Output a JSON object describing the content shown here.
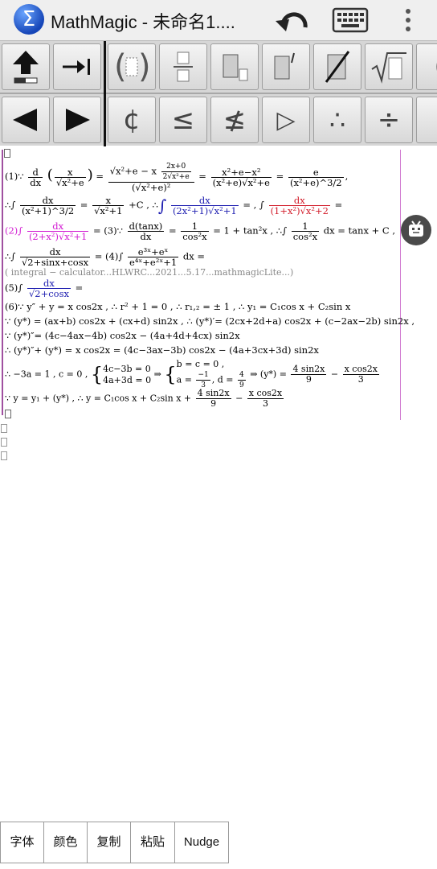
{
  "titlebar": {
    "app_icon_glyph": "Σ",
    "title": "MathMagic - 未命名1....",
    "undo_icon": "undo-icon",
    "keyboard_icon": "keyboard-icon",
    "menu_icon": "more-vertical-icon"
  },
  "toolbar": {
    "row1": [
      "arrow-up-icon",
      "tab-icon",
      "parentheses-template-icon",
      "fraction-template-icon",
      "subscript-template-icon",
      "prime-template-icon",
      "cancel-template-icon",
      "sqrt-template-icon",
      "more-template-icon"
    ],
    "row2": [
      "arrow-left-icon",
      "arrow-right-icon",
      "not-subset-icon",
      "less-equal-icon",
      "not-less-equal-icon",
      "triangle-right-icon",
      "therefore-icon",
      "divide-icon",
      "more-symbol-icon"
    ],
    "row2_glyphs": {
      "cent": "¢",
      "le": "≤",
      "nle": "≰",
      "tri": "▷",
      "therefore": "∴",
      "divide": "÷"
    }
  },
  "editor": {
    "l1_label": "(1)∵",
    "l1_d": "d",
    "l1_dx": "dx",
    "l1_x": "x",
    "l1_sqrt": "√x²+e",
    "l1_num": "√x²+e − x",
    "l1_num_frac_n": "2x+0",
    "l1_num_frac_d": "2√x²+e",
    "l1_den": "(√x²+e)²",
    "l1_r1n": "x²+e−x²",
    "l1_r1d": "(x²+e)√x²+e",
    "l1_r2n": "e",
    "l1_r2d": "(x²+e)^3/2",
    "l1_tail": ",",
    "l2_pre": "∴∫",
    "l2_f1n": "dx",
    "l2_f1d": "(x²+1)^3/2",
    "l2_f2n": "x",
    "l2_f2d": "√x²+1",
    "l2_mid": "+C , ∴",
    "l2_f3n": "dx",
    "l2_f3d": "(2x²+1)√x²+1",
    "l2_eq": "= , ∫",
    "l2_f4n": "dx",
    "l2_f4d": "(1+x²)√x²+2",
    "l2_end": "=",
    "l3_label": "(2)∫",
    "l3_f1n": "dx",
    "l3_f1d": "(2+x²)√x²+1",
    "l3_mid": "= (3)∵",
    "l3_f2n": "d(tanx)",
    "l3_f2d": "dx",
    "l3_eq": "=",
    "l3_f3n": "1",
    "l3_f3d": "cos²x",
    "l3_mid2": "= 1 + tan²x , ∴∫",
    "l3_f4n": "1",
    "l3_f4d": "cos²x",
    "l3_end": "dx = tanx + C ,",
    "l4_pre": "∴∫",
    "l4_f1n": "dx",
    "l4_f1d": "√2+sinx+cosx",
    "l4_mid": "= (4)∫",
    "l4_f2n": "e³ˣ+eˣ",
    "l4_f2d": "e⁴ˣ+e²ˣ+1",
    "l4_end": "dx =",
    "l5_watermark": "( integral − calculator...HLWRC...2021...5.17...mathmagicLite...)",
    "l6_label": "(5)∫",
    "l6_fn": "dx",
    "l6_fd": "√2+cosx",
    "l6_end": "=",
    "l7": "(6)∵ y″ + y = x cos2x , ∴ r² + 1 = 0 , ∴ r₁,₂ = ± 1 , ∴ y₁ = C₁cos x + C₂sin x",
    "l8": "∵ (y*) = (ax+b) cos2x + (cx+d) sin2x , ∴ (y*)′= (2cx+2d+a) cos2x + (c−2ax−2b) sin2x ,",
    "l9": "∵ (y*)″= (4c−4ax−4b) cos2x − (4a+4d+4cx) sin2x",
    "l10": "∴ (y*)″+ (y*) = x cos2x = (4c−3ax−3b) cos2x − (4a+3cx+3d) sin2x",
    "l11_pre": "∴ −3a = 1 , c = 0 ,",
    "l11_s1": "4c−3b = 0",
    "l11_s2": "4a+3d = 0",
    "l11_arrow": "⇒",
    "l11_s3": "b = c = 0 ,",
    "l11_s4a": "a =",
    "l11_s4n": "−1",
    "l11_s4d": "3",
    "l11_s4b": ", d =",
    "l11_s4n2": "4",
    "l11_s4d2": "9",
    "l11_res": "⇒ (y*) =",
    "l11_r1n": "4 sin2x",
    "l11_r1d": "9",
    "l11_minus": "−",
    "l11_r2n": "x cos2x",
    "l11_r2d": "3",
    "l12_pre": "∵ y = y₁ + (y*) , ∴ y = C₁cos x + C₂sin x +",
    "l12_r1n": "4 sin2x",
    "l12_r1d": "9",
    "l12_minus": "−",
    "l12_r2n": "x cos2x",
    "l12_r2d": "3"
  },
  "bottom": {
    "font": "字体",
    "color": "颜色",
    "copy": "复制",
    "paste": "粘贴",
    "nudge": "Nudge"
  }
}
